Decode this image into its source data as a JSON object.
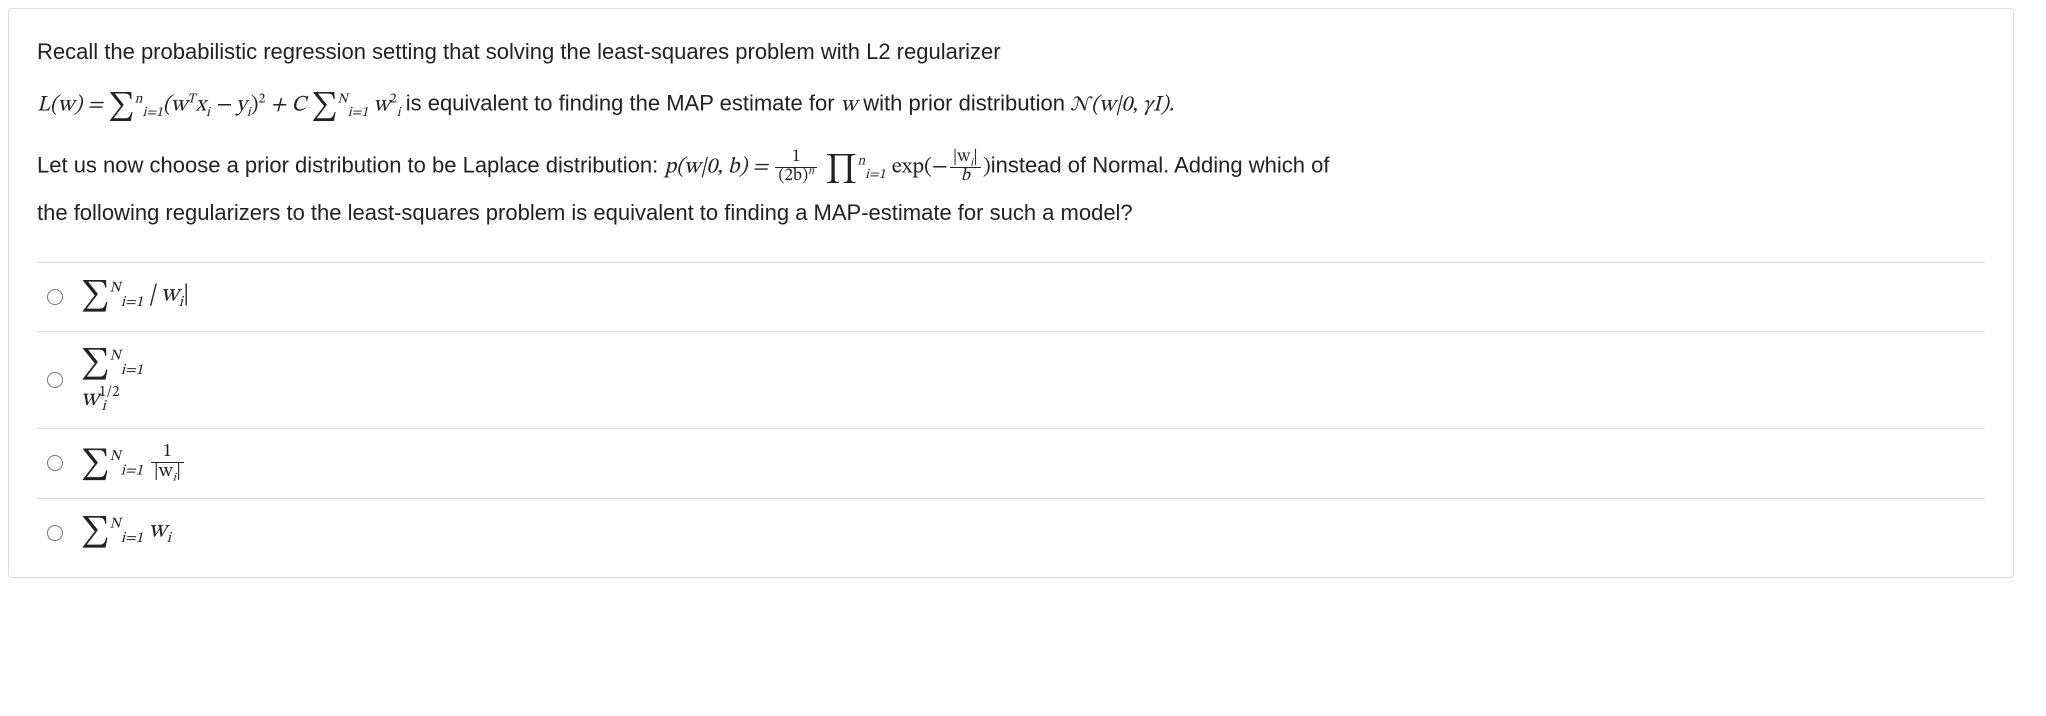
{
  "question": {
    "line1_a": "Recall the probabilistic regression setting that solving the least-squares problem with L2 regularizer",
    "line2_lhs": "L(w) = ",
    "line2_sum1_pre": "∑",
    "line2_sum1_top": "n",
    "line2_sum1_bot": "i=1",
    "line2_sum1_body": "(w",
    "line2_sum1_T": "T",
    "line2_sum1_x": "x",
    "line2_sum1_i1": "i",
    "line2_minus": " − y",
    "line2_sum1_i2": "i",
    "line2_sum1_close": ")",
    "line2_sq": "2",
    "line2_plusC": " + C ",
    "line2_sum2_pre": "∑",
    "line2_sum2_top": "N",
    "line2_sum2_bot": "i=1",
    "line2_w": " w",
    "line2_wsub": "i",
    "line2_wexp": "2",
    "line2_after": " is equivalent to finding the MAP estimate for ",
    "line2_w2": "w",
    "line2_after2": " with prior distribution ",
    "line2_N": "𝒩",
    "line2_Narg": "(w|0, γI).",
    "line3_a": "Let us now choose a prior distribution to be Laplace distribution: ",
    "line3_p": "p(w|0, b) = ",
    "line3_frac_num": "1",
    "line3_frac_den_a": "(2b)",
    "line3_frac_den_exp": "n",
    "line3_prod": " ∏",
    "line3_prod_top": "n",
    "line3_prod_bot": "i=1",
    "line3_exp": " exp(−",
    "line3_frac2_num": "|w",
    "line3_frac2_num_i": "i",
    "line3_frac2_num_close": "|",
    "line3_frac2_den": "b",
    "line3_close": ")",
    "line3_after": "instead of Normal. Adding which of",
    "line4": "the following regularizers to the least-squares problem is equivalent to finding a MAP-estimate for such a model?"
  },
  "options": {
    "a": {
      "sum": "∑",
      "top": "N",
      "bot": "i=1",
      "body_a": " | w",
      "body_i": "i",
      "body_b": "|"
    },
    "b": {
      "sum": "∑",
      "top": "N",
      "bot": "i=1",
      "body_a": " w",
      "body_i": "i",
      "exp": "1/2"
    },
    "c": {
      "sum": "∑",
      "top": "N",
      "bot": "i=1",
      "frac_num": "1",
      "frac_den_a": "|w",
      "frac_den_i": "i",
      "frac_den_b": "|"
    },
    "d": {
      "sum": "∑",
      "top": "N",
      "bot": "i=1",
      "body_a": " w",
      "body_i": "i"
    }
  }
}
